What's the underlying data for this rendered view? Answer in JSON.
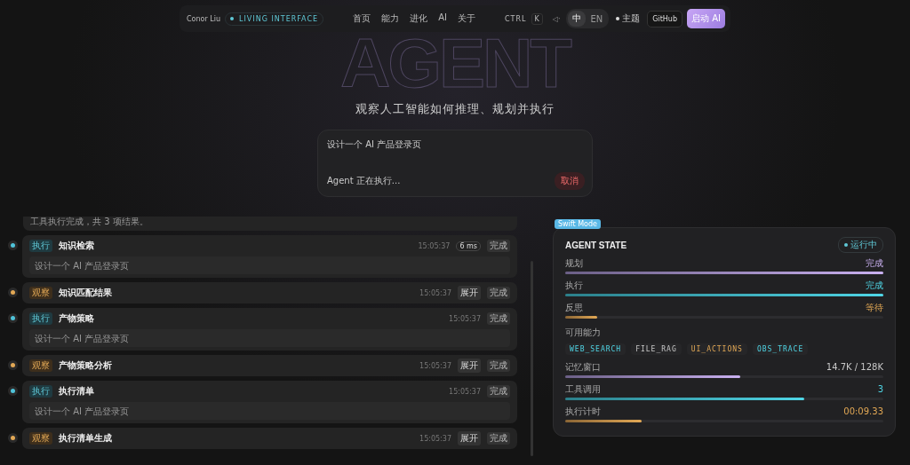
{
  "nav": {
    "brand": "Conor Liu",
    "tag": "LIVING INTERFACE",
    "links": [
      "首页",
      "能力",
      "进化",
      "AI",
      "关于"
    ],
    "shortcut": [
      "CTRL",
      "K"
    ],
    "sound": "◁·",
    "languages": [
      {
        "label": "中",
        "selected": true
      },
      {
        "label": "EN",
        "selected": false
      }
    ],
    "theme": "主题",
    "github": "GitHub",
    "cta": "启动 AI"
  },
  "hero": {
    "title": "AGENT",
    "subtitle": "观察人工智能如何推理、规划并执行"
  },
  "prompt": {
    "value": "设计一个 AI 产品登录页",
    "status": "Agent 正在执行...",
    "cancel": "取消"
  },
  "timeline": {
    "partial_text": "工具执行完成，共 3 项结果。",
    "items": [
      {
        "kind": "act",
        "tag": "执行",
        "title": "知识检索",
        "time": "15:05:37",
        "duration": "6 ms",
        "status": "完成",
        "body": "设计一个 AI 产品登录页"
      },
      {
        "kind": "observe",
        "tag": "观察",
        "title": "知识匹配结果",
        "time": "15:05:37",
        "expand": "展开",
        "status": "完成"
      },
      {
        "kind": "act",
        "tag": "执行",
        "title": "产物策略",
        "time": "15:05:37",
        "status": "完成",
        "body": "设计一个 AI 产品登录页"
      },
      {
        "kind": "observe",
        "tag": "观察",
        "title": "产物策略分析",
        "time": "15:05:37",
        "expand": "展开",
        "status": "完成"
      },
      {
        "kind": "act",
        "tag": "执行",
        "title": "执行清单",
        "time": "15:05:37",
        "status": "完成",
        "body": "设计一个 AI 产品登录页"
      },
      {
        "kind": "observe",
        "tag": "观察",
        "title": "执行清单生成",
        "time": "15:05:37",
        "expand": "展开",
        "status": "完成"
      }
    ]
  },
  "state": {
    "badge": "Swift Mode",
    "title": "AGENT STATE",
    "status": "运行中",
    "phases": [
      {
        "label": "规划",
        "value": "完成",
        "kind": "violet",
        "level": 1
      },
      {
        "label": "执行",
        "value": "完成",
        "kind": "cyan",
        "level": 1
      },
      {
        "label": "反思",
        "value": "等待",
        "kind": "amber",
        "level": 0.1
      }
    ],
    "tools_label": "可用能力",
    "tools": [
      {
        "label": "WEB_SEARCH",
        "kind": "cyan"
      },
      {
        "label": "FILE_RAG",
        "kind": "plain"
      },
      {
        "label": "UI_ACTIONS",
        "kind": "amber"
      },
      {
        "label": "OBS_TRACE",
        "kind": "cyan"
      }
    ],
    "metrics": [
      {
        "label": "记忆窗口",
        "value": "14.7K / 128K",
        "kind": "violet",
        "level": 0.55
      },
      {
        "label": "工具调用",
        "value": "3",
        "kind": "cyan",
        "level": 0.75
      },
      {
        "label": "执行计时",
        "value": "00:09.33",
        "kind": "amber",
        "level": 0.24
      }
    ]
  }
}
